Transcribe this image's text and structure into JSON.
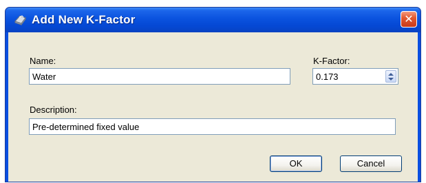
{
  "window": {
    "title": "Add New K-Factor",
    "close_glyph": "✕",
    "icon": "k-factor-app-icon"
  },
  "form": {
    "name_label": "Name:",
    "name_value": "Water",
    "kfactor_label": "K-Factor:",
    "kfactor_value": "0.173",
    "description_label": "Description:",
    "description_value": "Pre-determined fixed value"
  },
  "buttons": {
    "ok_label": "OK",
    "cancel_label": "Cancel"
  },
  "colors": {
    "titlebar": "#0548d4",
    "dialog_face": "#ece9d8",
    "close_button": "#e35a32"
  }
}
